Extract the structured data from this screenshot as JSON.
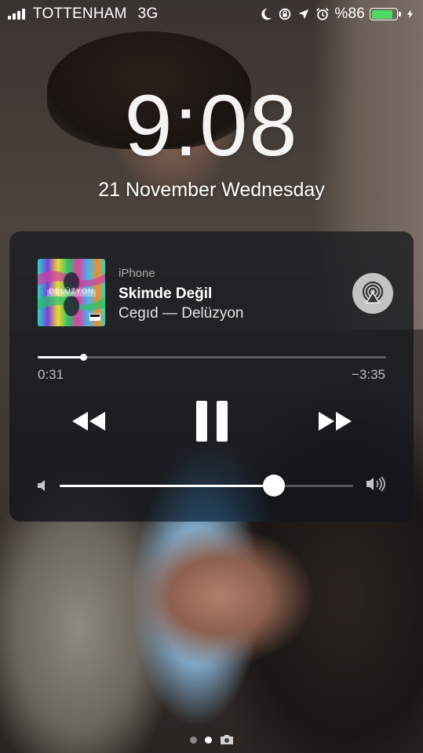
{
  "status_bar": {
    "carrier": "TOTTENHAM",
    "network": "3G",
    "battery_text": "%86",
    "battery_level": 0.86,
    "battery_color": "#4cd964",
    "icons": [
      "moon-icon",
      "rotation-lock-icon",
      "location-arrow-icon",
      "alarm-clock-icon",
      "battery-icon",
      "charging-bolt-icon"
    ]
  },
  "lock_screen": {
    "time": "9:08",
    "date": "21 November Wednesday"
  },
  "now_playing": {
    "source": "iPhone",
    "title": "Skimde Değil",
    "artist_album": "Cegıd — Delüzyon",
    "album_art_text": "DELÜZYON",
    "elapsed": "0:31",
    "remaining": "−3:35",
    "progress_fraction": 0.13,
    "volume_fraction": 0.73,
    "accent_color": "#2869a0"
  },
  "page_indicator": {
    "count": 2,
    "active_index": 1,
    "camera_icon": "camera-icon"
  }
}
